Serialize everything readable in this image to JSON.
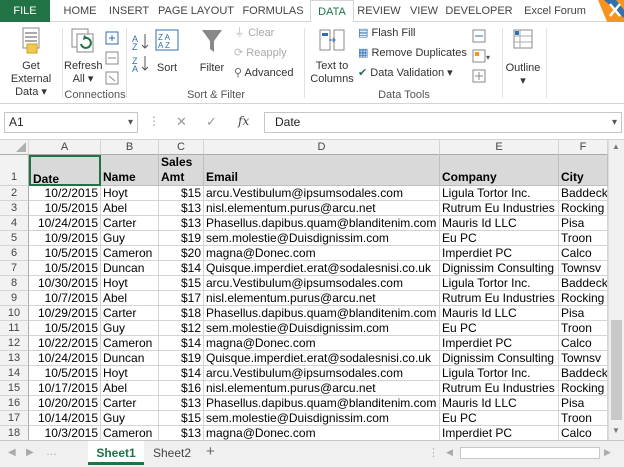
{
  "ribbon_tabs": [
    "FILE",
    "HOME",
    "INSERT",
    "PAGE LAYOUT",
    "FORMULAS",
    "DATA",
    "REVIEW",
    "VIEW",
    "DEVELOPER",
    "Excel Forum"
  ],
  "ribbon": {
    "get_external_line1": "Get External",
    "get_external_line2": "Data",
    "refresh_line1": "Refresh",
    "refresh_line2": "All",
    "connections_group": "Connections",
    "sort_label": "Sort",
    "filter_label": "Filter",
    "clear_label": "Clear",
    "reapply_label": "Reapply",
    "advanced_label": "Advanced",
    "sort_filter_group": "Sort & Filter",
    "text_to_columns_line1": "Text to",
    "text_to_columns_line2": "Columns",
    "flash_fill_label": "Flash Fill",
    "remove_duplicates_label": "Remove Duplicates",
    "data_validation_label": "Data Validation",
    "data_tools_group": "Data Tools",
    "outline_label": "Outline"
  },
  "formula_bar": {
    "name_box": "A1",
    "fx_label": "fx",
    "value": "Date"
  },
  "columns": [
    "A",
    "B",
    "C",
    "D",
    "E",
    "F"
  ],
  "header_row": {
    "date": "Date",
    "name": "Name",
    "sales_line1": "Sales",
    "sales_line2": "Amt",
    "email": "Email",
    "company": "Company",
    "city": "City"
  },
  "rows": [
    {
      "n": "2",
      "date": "10/2/2015",
      "name": "Hoyt",
      "amt": "$15",
      "email": "arcu.Vestibulum@ipsumsodales.com",
      "company": "Ligula Tortor Inc.",
      "city": "Baddeck"
    },
    {
      "n": "3",
      "date": "10/5/2015",
      "name": "Abel",
      "amt": "$13",
      "email": "nisl.elementum.purus@arcu.net",
      "company": "Rutrum Eu Industries",
      "city": "Rocking"
    },
    {
      "n": "4",
      "date": "10/24/2015",
      "name": "Carter",
      "amt": "$13",
      "email": "Phasellus.dapibus.quam@blanditenim.com",
      "company": "Mauris Id LLC",
      "city": "Pisa"
    },
    {
      "n": "5",
      "date": "10/9/2015",
      "name": "Guy",
      "amt": "$19",
      "email": "sem.molestie@Duisdignissim.com",
      "company": "Eu PC",
      "city": "Troon"
    },
    {
      "n": "6",
      "date": "10/5/2015",
      "name": "Cameron",
      "amt": "$20",
      "email": "magna@Donec.com",
      "company": "Imperdiet PC",
      "city": "Calco"
    },
    {
      "n": "7",
      "date": "10/5/2015",
      "name": "Duncan",
      "amt": "$14",
      "email": "Quisque.imperdiet.erat@sodalesnisi.co.uk",
      "company": "Dignissim Consulting",
      "city": "Townsv"
    },
    {
      "n": "8",
      "date": "10/30/2015",
      "name": "Hoyt",
      "amt": "$15",
      "email": "arcu.Vestibulum@ipsumsodales.com",
      "company": "Ligula Tortor Inc.",
      "city": "Baddeck"
    },
    {
      "n": "9",
      "date": "10/7/2015",
      "name": "Abel",
      "amt": "$17",
      "email": "nisl.elementum.purus@arcu.net",
      "company": "Rutrum Eu Industries",
      "city": "Rocking"
    },
    {
      "n": "10",
      "date": "10/29/2015",
      "name": "Carter",
      "amt": "$18",
      "email": "Phasellus.dapibus.quam@blanditenim.com",
      "company": "Mauris Id LLC",
      "city": "Pisa"
    },
    {
      "n": "11",
      "date": "10/5/2015",
      "name": "Guy",
      "amt": "$12",
      "email": "sem.molestie@Duisdignissim.com",
      "company": "Eu PC",
      "city": "Troon"
    },
    {
      "n": "12",
      "date": "10/22/2015",
      "name": "Cameron",
      "amt": "$14",
      "email": "magna@Donec.com",
      "company": "Imperdiet PC",
      "city": "Calco"
    },
    {
      "n": "13",
      "date": "10/24/2015",
      "name": "Duncan",
      "amt": "$19",
      "email": "Quisque.imperdiet.erat@sodalesnisi.co.uk",
      "company": "Dignissim Consulting",
      "city": "Townsv"
    },
    {
      "n": "14",
      "date": "10/5/2015",
      "name": "Hoyt",
      "amt": "$14",
      "email": "arcu.Vestibulum@ipsumsodales.com",
      "company": "Ligula Tortor Inc.",
      "city": "Baddeck"
    },
    {
      "n": "15",
      "date": "10/17/2015",
      "name": "Abel",
      "amt": "$16",
      "email": "nisl.elementum.purus@arcu.net",
      "company": "Rutrum Eu Industries",
      "city": "Rocking"
    },
    {
      "n": "16",
      "date": "10/20/2015",
      "name": "Carter",
      "amt": "$13",
      "email": "Phasellus.dapibus.quam@blanditenim.com",
      "company": "Mauris Id LLC",
      "city": "Pisa"
    },
    {
      "n": "17",
      "date": "10/14/2015",
      "name": "Guy",
      "amt": "$15",
      "email": "sem.molestie@Duisdignissim.com",
      "company": "Eu PC",
      "city": "Troon"
    },
    {
      "n": "18",
      "date": "10/3/2015",
      "name": "Cameron",
      "amt": "$13",
      "email": "magna@Donec.com",
      "company": "Imperdiet PC",
      "city": "Calco"
    }
  ],
  "sheet_tabs": [
    "Sheet1",
    "Sheet2"
  ],
  "add_sheet_symbol": "+",
  "colors": {
    "accent": "#217346",
    "header_fill": "#d9d9d9"
  }
}
